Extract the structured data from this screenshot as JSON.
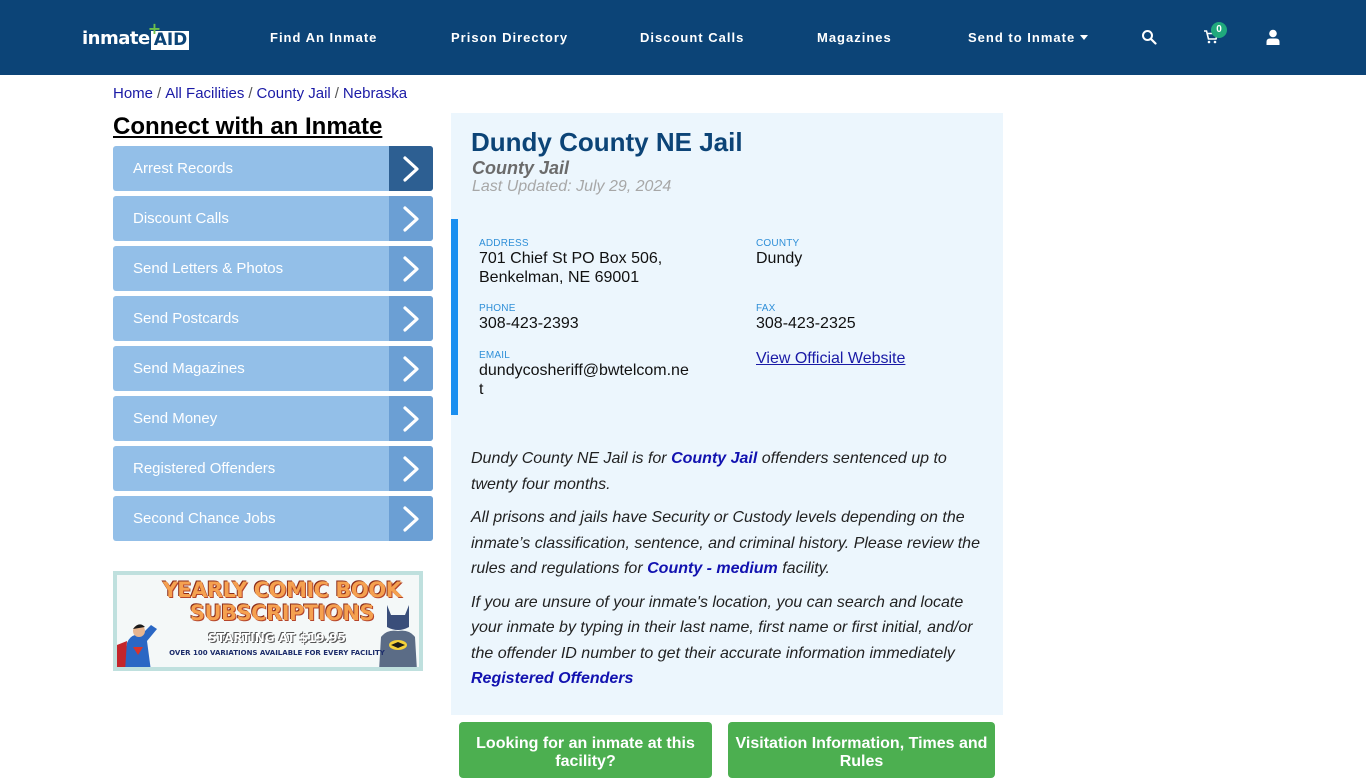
{
  "header": {
    "logo_text_main": "inmate",
    "logo_text_accent": "AID",
    "logo_plus": "+",
    "nav": [
      {
        "label": "Find An Inmate"
      },
      {
        "label": "Prison Directory"
      },
      {
        "label": "Discount Calls"
      },
      {
        "label": "Magazines"
      },
      {
        "label": "Send to Inmate",
        "has_dropdown": true
      }
    ],
    "icons": [
      "search-icon",
      "cart-icon",
      "user-icon"
    ],
    "cart_count": "0"
  },
  "breadcrumb": [
    {
      "label": "Home"
    },
    {
      "label": "All Facilities"
    },
    {
      "label": "County Jail"
    },
    {
      "label": "Nebraska"
    }
  ],
  "breadcrumb_separator": "/",
  "sidebar": {
    "title": "Connect with an Inmate",
    "items": [
      {
        "label": "Arrest Records"
      },
      {
        "label": "Discount Calls"
      },
      {
        "label": "Send Letters & Photos"
      },
      {
        "label": "Send Postcards"
      },
      {
        "label": "Send Magazines"
      },
      {
        "label": "Send Money"
      },
      {
        "label": "Registered Offenders"
      },
      {
        "label": "Second Chance Jobs"
      }
    ],
    "banner": {
      "line1": "YEARLY COMIC BOOK SUBSCRIPTIONS",
      "line2": "STARTING AT $19.95",
      "line3": "OVER 100 VARIATIONS AVAILABLE FOR EVERY FACILITY"
    }
  },
  "facility": {
    "name": "Dundy County NE Jail",
    "type": "County Jail",
    "last_updated": "Last Updated: July 29, 2024",
    "address_label": "ADDRESS",
    "address_line1": "701 Chief St PO Box 506,",
    "address_line2": "Benkelman, NE 69001",
    "county_label": "COUNTY",
    "county": "Dundy",
    "phone_label": "PHONE",
    "phone": "308-423-2393",
    "fax_label": "FAX",
    "fax": "308-423-2325",
    "email_label": "EMAIL",
    "email_line1": "dundycosheriff@bwtelcom.ne",
    "email_line2": "t",
    "website_link": "View Official Website"
  },
  "description": {
    "p1_before": "Dundy County NE Jail is for ",
    "p1_link": "County Jail",
    "p1_after": " offenders sentenced up to twenty four months.",
    "p2_before": "All prisons and jails have Security or Custody levels depending on the inmate’s classification, sentence, and criminal history. Please review the rules and regulations for ",
    "p2_link": "County - medium",
    "p2_after": " facility.",
    "p3": "If you are unsure of your inmate's location, you can search and locate your inmate by typing in their last name, first name or first initial, and/or the offender ID number to get their accurate information immediately",
    "p3_link": "Registered Offenders"
  },
  "buttons": {
    "find_inmate": "Looking for an inmate at this facility?",
    "visitation": "Visitation Information, Times and Rules"
  },
  "colors": {
    "header_bg": "#0c4477",
    "side_item_bg": "#93bfe8",
    "side_arrow_bg": "#6b9fd4",
    "side_arrow_active": "#2d5f92",
    "card_bg": "#ecf6fd",
    "accent_blue": "#1a8ff0",
    "green_button": "#4caf50",
    "cart_badge": "#20a97c"
  }
}
